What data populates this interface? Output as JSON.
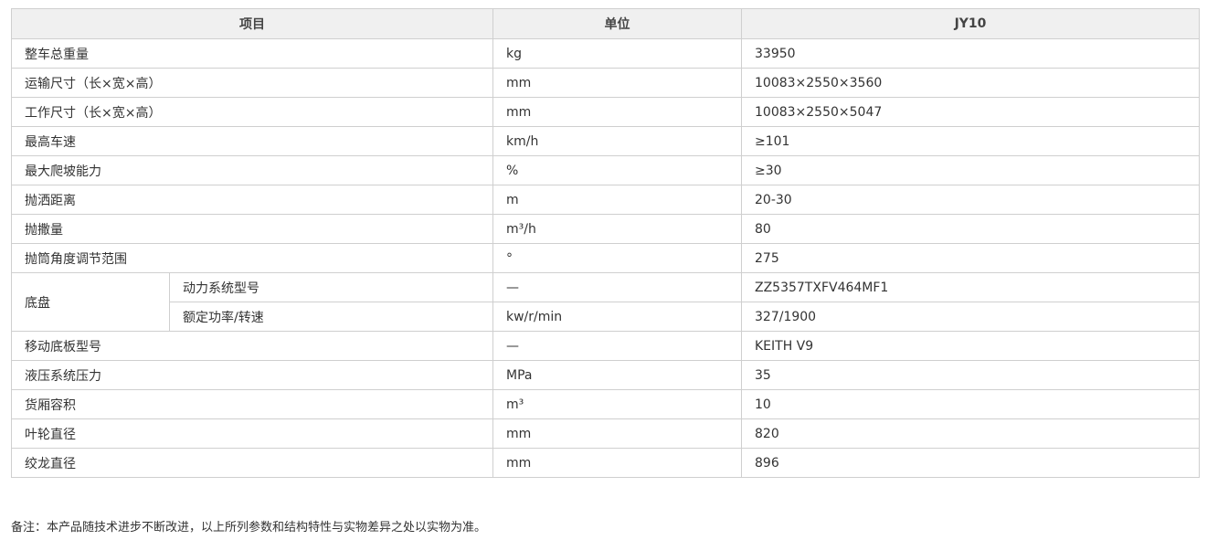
{
  "table": {
    "headers": {
      "item": "项目",
      "unit": "单位",
      "model": "JY10"
    },
    "rows": [
      {
        "item": "整车总重量",
        "unit": "kg",
        "value": "33950"
      },
      {
        "item": "运输尺寸（长×宽×高）",
        "unit": "mm",
        "value": "10083×2550×3560"
      },
      {
        "item": "工作尺寸（长×宽×高）",
        "unit": "mm",
        "value": "10083×2550×5047"
      },
      {
        "item": "最高车速",
        "unit": "km/h",
        "value": "≥101"
      },
      {
        "item": "最大爬坡能力",
        "unit": "%",
        "value": "≥30"
      },
      {
        "item": "抛洒距离",
        "unit": "m",
        "value": "20-30"
      },
      {
        "item": "抛撒量",
        "unit": "m³/h",
        "value": "80"
      },
      {
        "item": "抛筒角度调节范围",
        "unit": "°",
        "value": "275"
      }
    ],
    "chassis": {
      "label": "底盘",
      "sub_rows": [
        {
          "item": "动力系统型号",
          "unit": "—",
          "value": "ZZ5357TXFV464MF1"
        },
        {
          "item": "额定功率/转速",
          "unit": "kw/r/min",
          "value": "327/1900"
        }
      ]
    },
    "rows_after": [
      {
        "item": "移动底板型号",
        "unit": "—",
        "value": "KEITH V9"
      },
      {
        "item": "液压系统压力",
        "unit": "MPa",
        "value": "35"
      },
      {
        "item": "货厢容积",
        "unit": "m³",
        "value": "10"
      },
      {
        "item": "叶轮直径",
        "unit": "mm",
        "value": "820"
      },
      {
        "item": "绞龙直径",
        "unit": "mm",
        "value": "896"
      }
    ]
  },
  "note": "备注：本产品随技术进步不断改进，以上所列参数和结构特性与实物差异之处以实物为准。"
}
